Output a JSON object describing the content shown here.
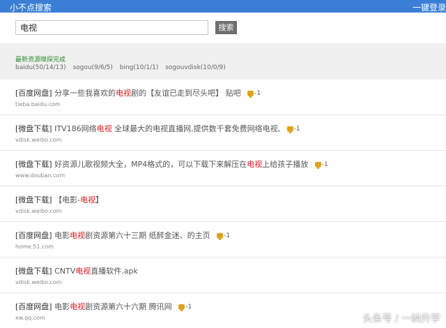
{
  "topbar": {
    "brand": "小不点搜索",
    "login": "一键登录"
  },
  "search": {
    "value": "电视",
    "button": "搜索"
  },
  "status": {
    "title": "最新资源嗅探完成",
    "sources": [
      "baidu(50/14/13)",
      "sogou(9/6/5)",
      "bing(10/1/1)",
      "sogouvdisk(10/0/9)"
    ]
  },
  "results": [
    {
      "tag": "[百度网盘]",
      "pre": "分享一些我喜欢的",
      "hl": "电视",
      "post": "剧的【友谊已走到尽头吧】 贴吧",
      "url": "tieba.baidu.com",
      "thumb": "-1"
    },
    {
      "tag": "[微盘下载]",
      "pre": "ITV186网络",
      "hl": "电视",
      "post": " 全球最大的电视直播网,提供数千套免费网络电视,",
      "url": "vdisk.weibo.com",
      "thumb": "-1"
    },
    {
      "tag": "[微盘下载]",
      "pre": "好资源儿歌视频大全，MP4格式的，可以下载下来解压在",
      "hl": "电视",
      "post": "上给孩子播放",
      "url": "www.douban.com",
      "thumb": "-1"
    },
    {
      "tag": "[微盘下载]",
      "pre": "【电影-",
      "hl": "电视",
      "post": "】",
      "url": "vdisk.weibo.com",
      "thumb": ""
    },
    {
      "tag": "[百度网盘]",
      "pre": "电影",
      "hl": "电视",
      "post": "剧资源第六十三期 纸醉金迷、的主页",
      "url": "home.51.com",
      "thumb": "-1"
    },
    {
      "tag": "[微盘下载]",
      "pre": "CNTV",
      "hl": "电视",
      "post": "直播软件.apk",
      "url": "vdisk.weibo.com",
      "thumb": ""
    },
    {
      "tag": "[百度网盘]",
      "pre": "电影",
      "hl": "电视",
      "post": "剧资源第六十六期 腾讯网",
      "url": "xw.qq.com",
      "thumb": "-1"
    }
  ],
  "watermark": "头条号 / 一纳升学"
}
